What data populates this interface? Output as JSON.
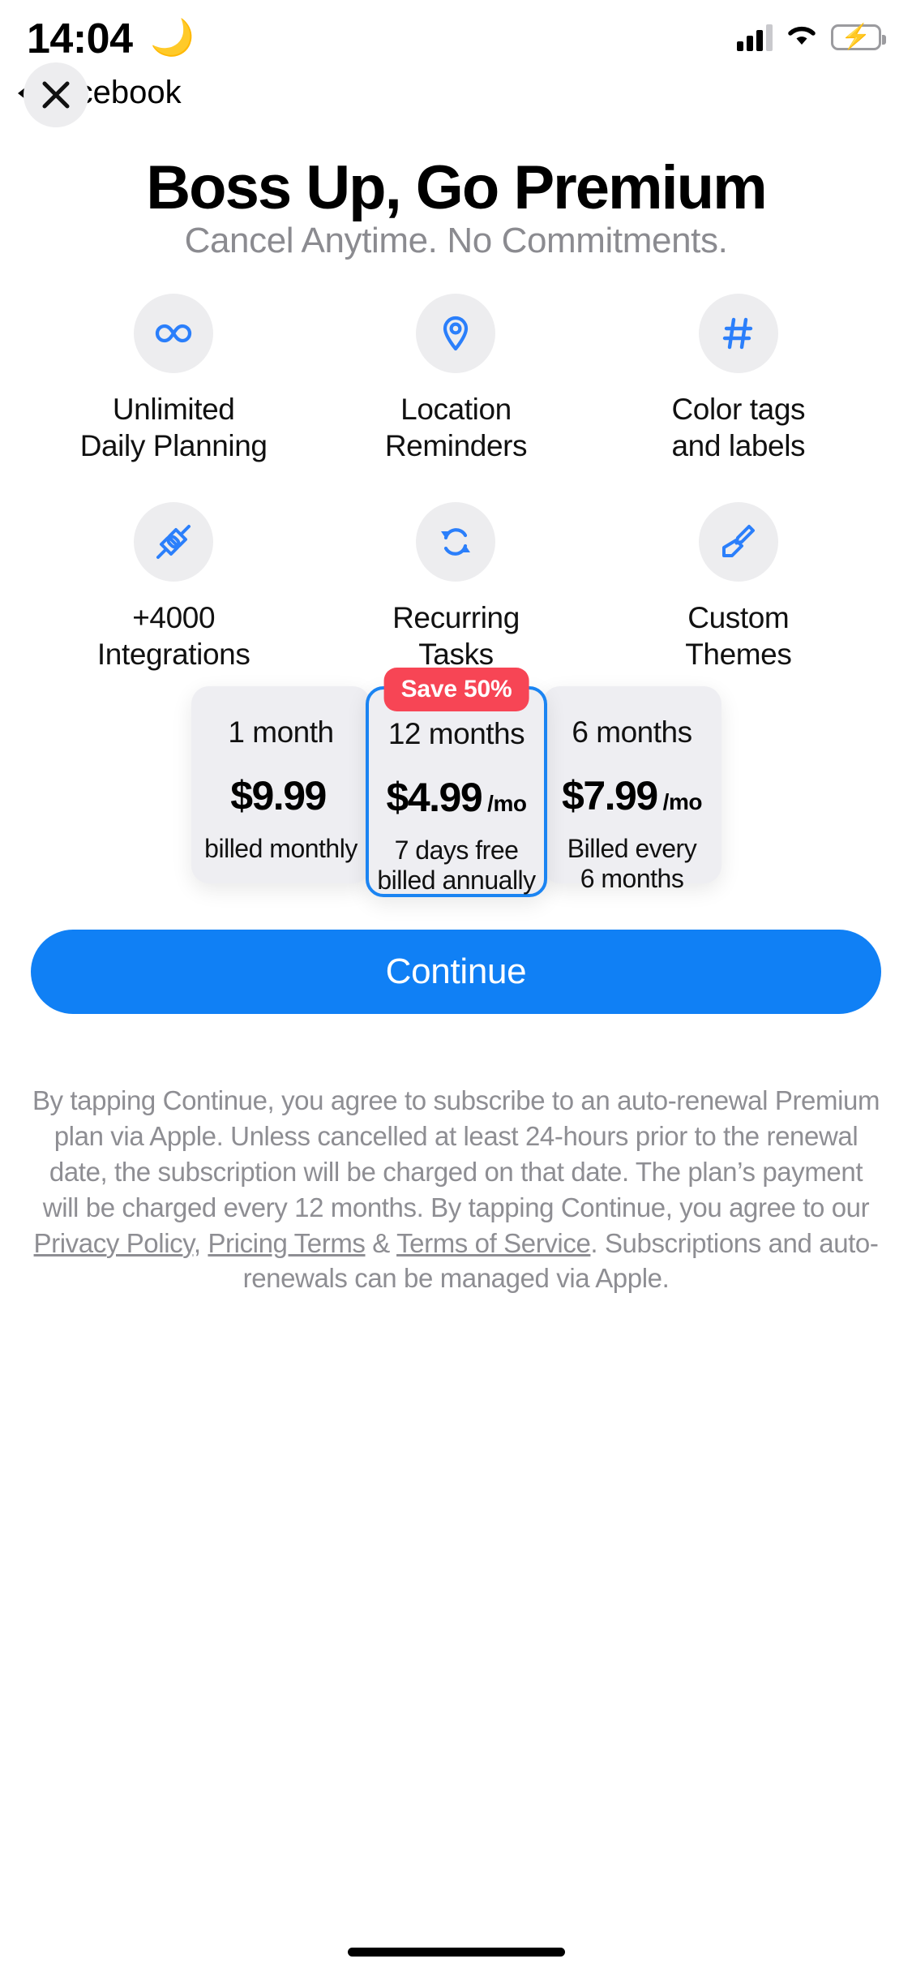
{
  "status_bar": {
    "time": "14:04",
    "dnd_icon": "moon-icon",
    "signal_icon": "cellular-signal-icon",
    "wifi_icon": "wifi-icon",
    "battery_icon": "battery-charging-icon"
  },
  "back_link": {
    "label": "Facebook"
  },
  "close_button": {
    "icon": "close-x-icon"
  },
  "header": {
    "title": "Boss Up, Go Premium",
    "subtitle": "Cancel Anytime. No Commitments."
  },
  "features": [
    {
      "icon": "infinity-icon",
      "label": "Unlimited\nDaily Planning"
    },
    {
      "icon": "location-pin-icon",
      "label": "Location\nReminders"
    },
    {
      "icon": "hashtag-icon",
      "label": "Color tags\nand labels"
    },
    {
      "icon": "plug-connect-icon",
      "label": "+4000\nIntegrations"
    },
    {
      "icon": "recurring-refresh-icon",
      "label": "Recurring\nTasks"
    },
    {
      "icon": "paintbrush-icon",
      "label": "Custom\nThemes"
    }
  ],
  "plans": [
    {
      "term": "1 month",
      "amount": "$9.99",
      "per": "",
      "note": "billed monthly",
      "selected": false,
      "badge": ""
    },
    {
      "term": "12 months",
      "amount": "$4.99",
      "per": "/mo",
      "note": "7 days free\nbilled annually",
      "selected": true,
      "badge": "Save 50%"
    },
    {
      "term": "6 months",
      "amount": "$7.99",
      "per": "/mo",
      "note": "Billed every\n6 months",
      "selected": false,
      "badge": ""
    }
  ],
  "continue_button": {
    "label": "Continue"
  },
  "legal": {
    "part1": "By tapping Continue, you agree to subscribe to an auto-renewal Premium plan via Apple. Unless cancelled at least 24-hours prior to the renewal date, the subscription will be charged on that date. The plan’s payment will be charged every 12 months. By tapping Continue, you agree to our ",
    "link_privacy": "Privacy Policy,",
    "link_pricing": "Pricing Terms",
    "amp": " & ",
    "link_terms": "Terms of Service",
    "part2": ". Subscriptions and auto-renewals can be managed via Apple."
  },
  "colors": {
    "accent_blue": "#1080f5",
    "badge_red": "#f74555",
    "icon_blue": "#2b7ffb",
    "card_gray": "#eeeef2",
    "muted_text": "#8e8e93"
  }
}
